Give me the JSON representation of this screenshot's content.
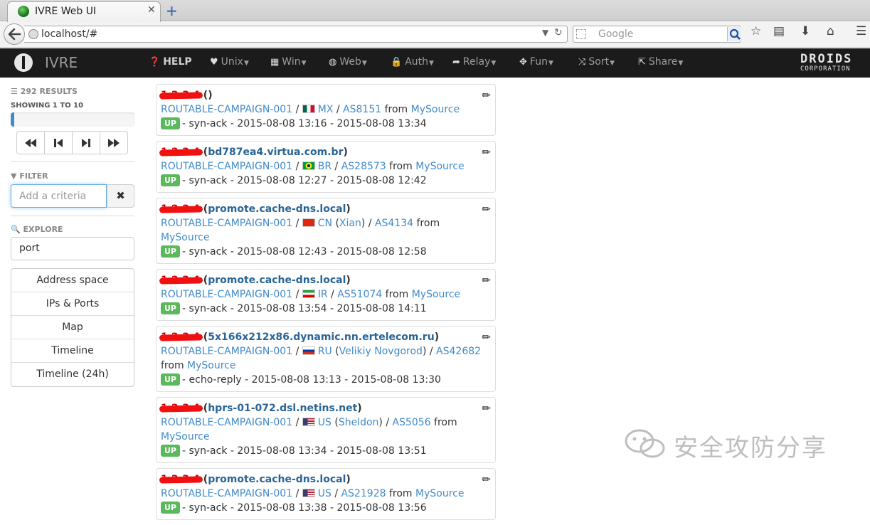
{
  "browser": {
    "tab_title": "IVRE Web UI",
    "tab_close": "✕",
    "new_tab": "+",
    "url": "localhost/#",
    "search_placeholder": "Google"
  },
  "app": {
    "brand": "IVRE",
    "menu": [
      {
        "label": "HELP",
        "icon": "question-circle-icon",
        "caret": false
      },
      {
        "label": "Unix",
        "icon": "heart-icon",
        "caret": true
      },
      {
        "label": "Win",
        "icon": "windows-grid-icon",
        "caret": true
      },
      {
        "label": "Web",
        "icon": "globe-icon",
        "caret": true
      },
      {
        "label": "Auth",
        "icon": "lock-icon",
        "caret": true
      },
      {
        "label": "Relay",
        "icon": "share-arrow-icon",
        "caret": true
      },
      {
        "label": "Fun",
        "icon": "move-arrows-icon",
        "caret": true
      },
      {
        "label": "Sort",
        "icon": "random-icon",
        "caret": true
      },
      {
        "label": "Share",
        "icon": "share-box-icon",
        "caret": true
      }
    ],
    "partner_logo": {
      "line1": "DROIDS",
      "line2": "CORPORATION"
    }
  },
  "sidebar": {
    "results_count": "292 RESULTS",
    "showing": "SHOWING 1 TO 10",
    "progress_fraction": 0.03,
    "filter_heading": "FILTER",
    "filter_placeholder": "Add a criteria",
    "filter_clear": "✖",
    "explore_heading": "EXPLORE",
    "explore_value": "port",
    "explore_items": [
      "Address space",
      "IPs & Ports",
      "Map",
      "Timeline",
      "Timeline (24h)"
    ]
  },
  "results": [
    {
      "ip_hidden": "1.2.3.4",
      "hostname": "",
      "category": "ROUTABLE-CAMPAIGN-001",
      "country": "MX",
      "flag": "mx",
      "city": "",
      "as": "AS8151",
      "source": "MySource",
      "state": "UP",
      "reason": "syn-ack",
      "time": "2015-08-08 13:16 - 2015-08-08 13:34"
    },
    {
      "ip_hidden": "1.2.3.4",
      "hostname": "bd787ea4.virtua.com.br",
      "category": "ROUTABLE-CAMPAIGN-001",
      "country": "BR",
      "flag": "br",
      "city": "",
      "as": "AS28573",
      "source": "MySource",
      "state": "UP",
      "reason": "syn-ack",
      "time": "2015-08-08 12:27 - 2015-08-08 12:42"
    },
    {
      "ip_hidden": "1.2.3.4",
      "hostname": "promote.cache-dns.local",
      "category": "ROUTABLE-CAMPAIGN-001",
      "country": "CN",
      "flag": "cn",
      "city": "Xian",
      "as": "AS4134",
      "source": "MySource",
      "state": "UP",
      "reason": "syn-ack",
      "time": "2015-08-08 12:43 - 2015-08-08 12:58"
    },
    {
      "ip_hidden": "1.2.3.4",
      "hostname": "promote.cache-dns.local",
      "category": "ROUTABLE-CAMPAIGN-001",
      "country": "IR",
      "flag": "ir",
      "city": "",
      "as": "AS51074",
      "source": "MySource",
      "state": "UP",
      "reason": "syn-ack",
      "time": "2015-08-08 13:54 - 2015-08-08 14:11"
    },
    {
      "ip_hidden": "1.2.3.4",
      "hostname": "5x166x212x86.dynamic.nn.ertelecom.ru",
      "category": "ROUTABLE-CAMPAIGN-001",
      "country": "RU",
      "flag": "ru",
      "city": "Velikiy Novgorod",
      "as": "AS42682",
      "source": "MySource",
      "state": "UP",
      "reason": "echo-reply",
      "time": "2015-08-08 13:13 - 2015-08-08 13:30"
    },
    {
      "ip_hidden": "1.2.3.4",
      "hostname": "hprs-01-072.dsl.netins.net",
      "category": "ROUTABLE-CAMPAIGN-001",
      "country": "US",
      "flag": "us",
      "city": "Sheldon",
      "as": "AS5056",
      "source": "MySource",
      "state": "UP",
      "reason": "syn-ack",
      "time": "2015-08-08 13:34 - 2015-08-08 13:51"
    },
    {
      "ip_hidden": "1.2.3.4",
      "hostname": "promote.cache-dns.local",
      "category": "ROUTABLE-CAMPAIGN-001",
      "country": "US",
      "flag": "us",
      "city": "",
      "as": "AS21928",
      "source": "MySource",
      "state": "UP",
      "reason": "syn-ack",
      "time": "2015-08-08 13:38 - 2015-08-08 13:56"
    }
  ],
  "watermark": "安全攻防分享"
}
